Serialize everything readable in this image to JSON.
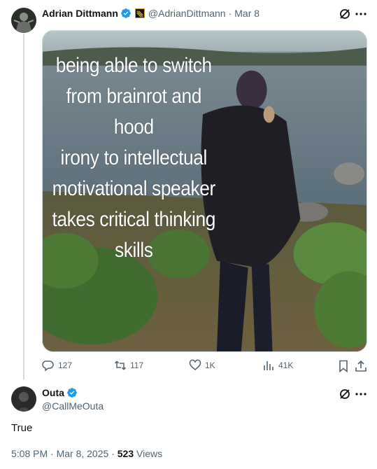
{
  "tweet": {
    "author_name": "Adrian Dittmann",
    "author_handle": "@AdrianDittmann",
    "date": "Mar 8",
    "media_caption_lines": [
      "being able to switch",
      "from brainrot and hood",
      "irony to intellectual",
      "motivational speaker",
      "takes critical thinking",
      "skills"
    ],
    "stats": {
      "replies": "127",
      "reposts": "117",
      "likes": "1K",
      "views": "41K"
    }
  },
  "reply": {
    "author_name": "Outa",
    "author_handle": "@CallMeOuta",
    "text": "True",
    "timestamp": "5:08 PM · Mar 8, 2025",
    "separator": "·",
    "view_count": "523",
    "views_label": "Views"
  },
  "colors": {
    "verified_blue": "#1d9bf0",
    "secondary_text": "#536471",
    "thread_line": "#cfd9de"
  },
  "icons": [
    "grok-icon",
    "more-icon",
    "reply-icon",
    "repost-icon",
    "like-icon",
    "views-icon",
    "bookmark-icon",
    "share-icon",
    "verified-badge-icon",
    "affiliate-badge-icon"
  ]
}
